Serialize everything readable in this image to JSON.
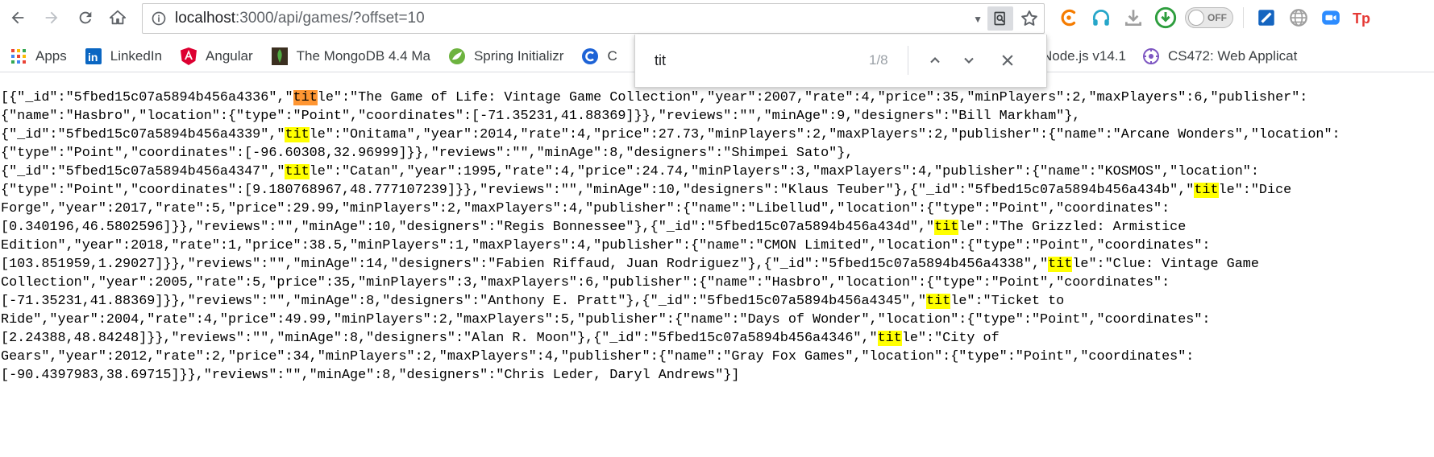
{
  "browser": {
    "url_host": "localhost",
    "url_path": ":3000/api/games/?offset=10",
    "toggle_label": "OFF"
  },
  "bookmarks": [
    {
      "label": "Apps",
      "icon": "apps-grid-icon"
    },
    {
      "label": "LinkedIn",
      "icon": "linkedin-icon"
    },
    {
      "label": "Angular",
      "icon": "angular-icon"
    },
    {
      "label": "The MongoDB 4.4 Ma",
      "icon": "mongodb-icon"
    },
    {
      "label": "Spring Initializr",
      "icon": "spring-icon"
    },
    {
      "label": "C",
      "icon": "c-icon"
    }
  ],
  "bookmarks_right": [
    {
      "label": "Node.js v14.1",
      "icon": "nodejs-icon"
    },
    {
      "label": "CS472: Web Applicat",
      "icon": "cs472-icon"
    }
  ],
  "find": {
    "query": "tit",
    "count": "1/8"
  },
  "content": {
    "lines": [
      [
        {
          "t": "[{\"_id\":\"5fbed15c07a5894b456a4336\",\""
        },
        {
          "h": "tit",
          "cur": true
        },
        {
          "t": "le\":\"The Game of Life: Vintage Game Collection\",\"year\":2007,\"rate\":4,\"price\":35,\"minPlayers\":2,\"maxPlayers\":6,\"publisher\":"
        }
      ],
      [
        {
          "t": "{\"name\":\"Hasbro\",\"location\":{\"type\":\"Point\",\"coordinates\":[-71.35231,41.88369]}},\"reviews\":\"\",\"minAge\":9,\"designers\":\"Bill Markham\"},"
        }
      ],
      [
        {
          "t": "{\"_id\":\"5fbed15c07a5894b456a4339\",\""
        },
        {
          "h": "tit"
        },
        {
          "t": "le\":\"Onitama\",\"year\":2014,\"rate\":4,\"price\":27.73,\"minPlayers\":2,\"maxPlayers\":2,\"publisher\":{\"name\":\"Arcane Wonders\",\"location\":"
        }
      ],
      [
        {
          "t": "{\"type\":\"Point\",\"coordinates\":[-96.60308,32.96999]}},\"reviews\":\"\",\"minAge\":8,\"designers\":\"Shimpei Sato\"},"
        }
      ],
      [
        {
          "t": "{\"_id\":\"5fbed15c07a5894b456a4347\",\""
        },
        {
          "h": "tit"
        },
        {
          "t": "le\":\"Catan\",\"year\":1995,\"rate\":4,\"price\":24.74,\"minPlayers\":3,\"maxPlayers\":4,\"publisher\":{\"name\":\"KOSMOS\",\"location\":"
        }
      ],
      [
        {
          "t": "{\"type\":\"Point\",\"coordinates\":[9.180768967,48.777107239]}},\"reviews\":\"\",\"minAge\":10,\"designers\":\"Klaus Teuber\"},{\"_id\":\"5fbed15c07a5894b456a434b\",\""
        },
        {
          "h": "tit"
        },
        {
          "t": "le\":\"Dice"
        }
      ],
      [
        {
          "t": "Forge\",\"year\":2017,\"rate\":5,\"price\":29.99,\"minPlayers\":2,\"maxPlayers\":4,\"publisher\":{\"name\":\"Libellud\",\"location\":{\"type\":\"Point\",\"coordinates\":"
        }
      ],
      [
        {
          "t": "[0.340196,46.5802596]}},\"reviews\":\"\",\"minAge\":10,\"designers\":\"Regis Bonnessee\"},{\"_id\":\"5fbed15c07a5894b456a434d\",\""
        },
        {
          "h": "tit"
        },
        {
          "t": "le\":\"The Grizzled: Armistice"
        }
      ],
      [
        {
          "t": "Edition\",\"year\":2018,\"rate\":1,\"price\":38.5,\"minPlayers\":1,\"maxPlayers\":4,\"publisher\":{\"name\":\"CMON Limited\",\"location\":{\"type\":\"Point\",\"coordinates\":"
        }
      ],
      [
        {
          "t": "[103.851959,1.29027]}},\"reviews\":\"\",\"minAge\":14,\"designers\":\"Fabien Riffaud, Juan Rodriguez\"},{\"_id\":\"5fbed15c07a5894b456a4338\",\""
        },
        {
          "h": "tit"
        },
        {
          "t": "le\":\"Clue: Vintage Game"
        }
      ],
      [
        {
          "t": "Collection\",\"year\":2005,\"rate\":5,\"price\":35,\"minPlayers\":3,\"maxPlayers\":6,\"publisher\":{\"name\":\"Hasbro\",\"location\":{\"type\":\"Point\",\"coordinates\":"
        }
      ],
      [
        {
          "t": "[-71.35231,41.88369]}},\"reviews\":\"\",\"minAge\":8,\"designers\":\"Anthony E. Pratt\"},{\"_id\":\"5fbed15c07a5894b456a4345\",\""
        },
        {
          "h": "tit"
        },
        {
          "t": "le\":\"Ticket to"
        }
      ],
      [
        {
          "t": "Ride\",\"year\":2004,\"rate\":4,\"price\":49.99,\"minPlayers\":2,\"maxPlayers\":5,\"publisher\":{\"name\":\"Days of Wonder\",\"location\":{\"type\":\"Point\",\"coordinates\":"
        }
      ],
      [
        {
          "t": "[2.24388,48.84248]}},\"reviews\":\"\",\"minAge\":8,\"designers\":\"Alan R. Moon\"},{\"_id\":\"5fbed15c07a5894b456a4346\",\""
        },
        {
          "h": "tit"
        },
        {
          "t": "le\":\"City of"
        }
      ],
      [
        {
          "t": "Gears\",\"year\":2012,\"rate\":2,\"price\":34,\"minPlayers\":2,\"maxPlayers\":4,\"publisher\":{\"name\":\"Gray Fox Games\",\"location\":{\"type\":\"Point\",\"coordinates\":"
        }
      ],
      [
        {
          "t": "[-90.4397983,38.69715]}},\"reviews\":\"\",\"minAge\":8,\"designers\":\"Chris Leder, Daryl Andrews\"}]"
        }
      ]
    ]
  },
  "colors": {
    "highlight": "#ffff00",
    "current_highlight": "#ff9632"
  }
}
